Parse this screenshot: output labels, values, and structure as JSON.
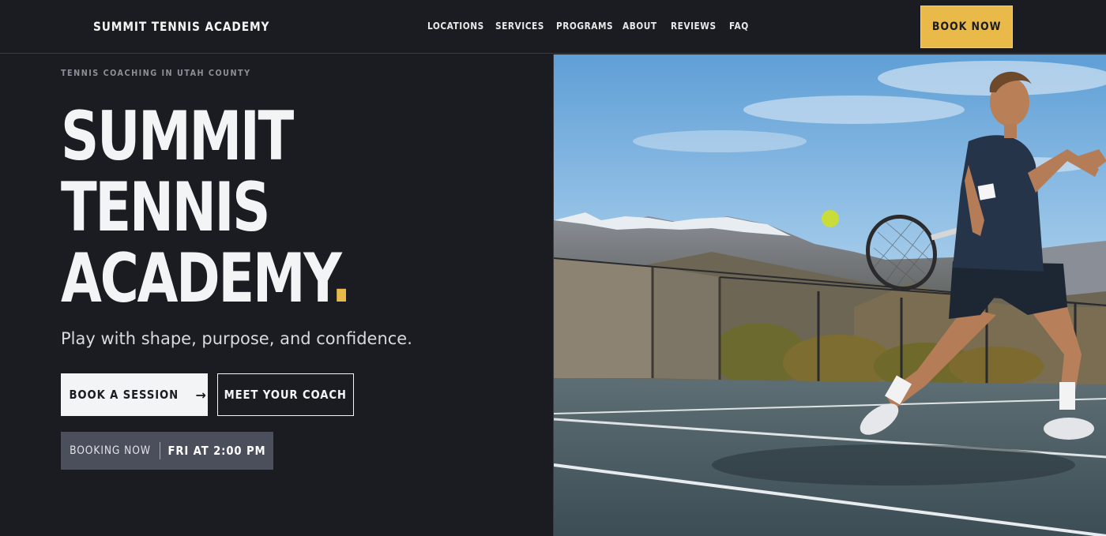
{
  "nav": {
    "brand": "SUMMIT TENNIS ACADEMY",
    "items": [
      {
        "label": "LOCATIONS"
      },
      {
        "label": "SERVICES"
      },
      {
        "label": "PROGRAMS"
      },
      {
        "label": "ABOUT"
      },
      {
        "label": "REVIEWS"
      },
      {
        "label": "FAQ"
      }
    ],
    "cta": "BOOK NOW"
  },
  "hero": {
    "eyebrow": "TENNIS COACHING IN UTAH COUNTY",
    "title_line1": "SUMMIT",
    "title_line2": "TENNIS",
    "title_line3": "ACADEMY",
    "title_dot": ".",
    "tagline": "Play with shape, purpose, and confidence.",
    "primary_button": "BOOK A SESSION",
    "primary_arrow": "→",
    "secondary_button": "MEET YOUR COACH",
    "booking_label": "BOOKING NOW",
    "booking_time": "FRI AT 2:00 PM"
  },
  "colors": {
    "background": "#1b1c21",
    "accent": "#e9b949",
    "text": "#f3f4f6",
    "booking_bg": "#4b4e5b"
  },
  "image": {
    "subject": "tennis-player-forehand-mountains"
  }
}
